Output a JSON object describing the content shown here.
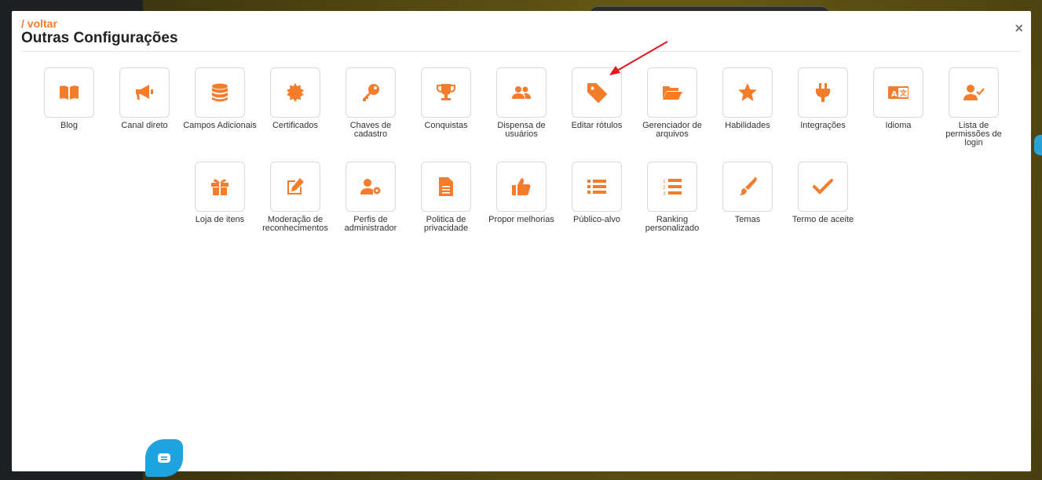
{
  "modal": {
    "back_link": "/ voltar",
    "title": "Outras Configurações",
    "close": "×"
  },
  "colors": {
    "accent": "#f47c2a",
    "arrow": "#e8131b",
    "chat": "#1fa3df"
  },
  "tiles": [
    {
      "label": "Blog",
      "icon": "book-icon"
    },
    {
      "label": "Canal direto",
      "icon": "megaphone-icon"
    },
    {
      "label": "Campos Adicionais",
      "icon": "database-icon"
    },
    {
      "label": "Certificados",
      "icon": "certificate-icon"
    },
    {
      "label": "Chaves de cadastro",
      "icon": "key-icon"
    },
    {
      "label": "Conquistas",
      "icon": "trophy-icon"
    },
    {
      "label": "Dispensa de usuários",
      "icon": "users-icon"
    },
    {
      "label": "Editar rótulos",
      "icon": "tag-icon"
    },
    {
      "label": "Gerenciador de arquivos",
      "icon": "folder-open-icon"
    },
    {
      "label": "Habilidades",
      "icon": "star-icon"
    },
    {
      "label": "Integrações",
      "icon": "plug-icon"
    },
    {
      "label": "Idioma",
      "icon": "language-icon"
    },
    {
      "label": "Lista de permissões de login",
      "icon": "user-check-icon"
    },
    {
      "label": "Loja de itens",
      "icon": "gift-icon"
    },
    {
      "label": "Moderação de reconhecimentos",
      "icon": "edit-icon"
    },
    {
      "label": "Perfis de administrador",
      "icon": "user-cog-icon"
    },
    {
      "label": "Politica de privacidade",
      "icon": "document-icon"
    },
    {
      "label": "Propor melhorias",
      "icon": "thumbs-up-icon"
    },
    {
      "label": "Público-alvo",
      "icon": "list-icon"
    },
    {
      "label": "Ranking personalizado",
      "icon": "ordered-list-icon"
    },
    {
      "label": "Temas",
      "icon": "paint-brush-icon"
    },
    {
      "label": "Termo de aceite",
      "icon": "check-icon"
    }
  ]
}
